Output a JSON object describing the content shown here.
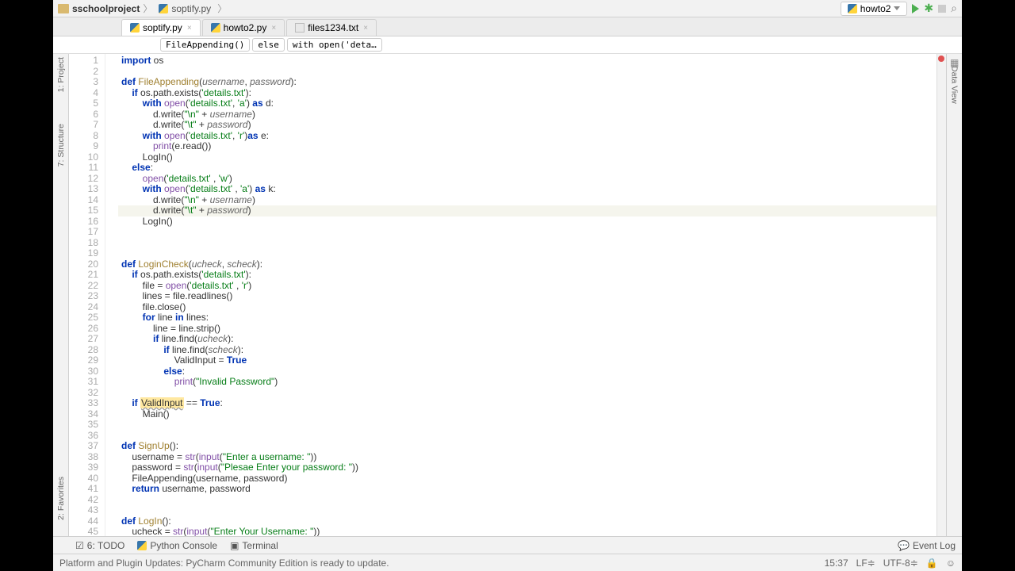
{
  "breadcrumb": {
    "project": "sschoolproject",
    "file": "soptify.py"
  },
  "run_config": "howto2",
  "tabs": [
    {
      "name": "soptify.py",
      "type": "py",
      "active": true
    },
    {
      "name": "howto2.py",
      "type": "py",
      "active": false
    },
    {
      "name": "files1234.txt",
      "type": "txt",
      "active": false
    }
  ],
  "context": [
    "FileAppending()",
    "else",
    "with open('deta…"
  ],
  "left_tools": [
    "1: Project",
    "7: Structure"
  ],
  "bottom_left_tool": "2: Favorites",
  "right_tool": "Data View",
  "bottom_tools": {
    "todo": "6: TODO",
    "console": "Python Console",
    "terminal": "Terminal",
    "event_log": "Event Log"
  },
  "status": {
    "msg": "Platform and Plugin Updates: PyCharm Community Edition is ready to update.",
    "time": "15:37",
    "sep": "LF≑",
    "enc": "UTF-8≑"
  },
  "code": [
    {
      "n": 1,
      "t": "<span class='kw'>import</span> os"
    },
    {
      "n": 2,
      "t": ""
    },
    {
      "n": 3,
      "t": "<span class='kw'>def</span> <span class='fn'>FileAppending</span>(<span class='param'>username</span>, <span class='param'>password</span>):"
    },
    {
      "n": 4,
      "t": "    <span class='kw'>if</span> os.path.exists(<span class='str'>'details.txt'</span>):"
    },
    {
      "n": 5,
      "t": "        <span class='kw'>with</span> <span class='bi'>open</span>(<span class='str'>'details.txt'</span>, <span class='str'>'a'</span>) <span class='kw'>as</span> d:"
    },
    {
      "n": 6,
      "t": "            d.write(<span class='str'>\"\\n\"</span> + <span class='param'>username</span>)"
    },
    {
      "n": 7,
      "t": "            d.write(<span class='str'>\"\\t\"</span> + <span class='param'>password</span>)"
    },
    {
      "n": 8,
      "t": "        <span class='kw'>with</span> <span class='bi'>open</span>(<span class='str'>'details.txt'</span>, <span class='str'>'r'</span>)<span class='kw'>as</span> e:"
    },
    {
      "n": 9,
      "t": "            <span class='bi'>print</span>(e.read())"
    },
    {
      "n": 10,
      "t": "        LogIn()"
    },
    {
      "n": 11,
      "t": "    <span class='kw'>else</span>:"
    },
    {
      "n": 12,
      "t": "        <span class='bi'>open</span>(<span class='str'>'details.txt'</span> , <span class='str'>'w'</span>)"
    },
    {
      "n": 13,
      "t": "        <span class='kw'>with</span> <span class='bi'>open</span>(<span class='str'>'details.txt'</span> , <span class='str'>'a'</span>) <span class='kw'>as</span> k:"
    },
    {
      "n": 14,
      "t": "            d.write(<span class='str'>\"\\n\"</span> + <span class='param'>username</span>)"
    },
    {
      "n": 15,
      "t": "            d.write(<span class='str'>\"\\t\"</span> + <span class='param'>password</span>)",
      "hl": true
    },
    {
      "n": 16,
      "t": "        LogIn()"
    },
    {
      "n": 17,
      "t": ""
    },
    {
      "n": 18,
      "t": ""
    },
    {
      "n": 19,
      "t": ""
    },
    {
      "n": 20,
      "t": "<span class='kw'>def</span> <span class='fn'>LoginCheck</span>(<span class='param'>ucheck</span>, <span class='param'>scheck</span>):"
    },
    {
      "n": 21,
      "t": "    <span class='kw'>if</span> os.path.exists(<span class='str'>'details.txt'</span>):"
    },
    {
      "n": 22,
      "t": "        file = <span class='bi'>open</span>(<span class='str'>'details.txt'</span> , <span class='str'>'r'</span>)"
    },
    {
      "n": 23,
      "t": "        lines = file.readlines()"
    },
    {
      "n": 24,
      "t": "        file.close()"
    },
    {
      "n": 25,
      "t": "        <span class='kw'>for</span> line <span class='kw'>in</span> lines:"
    },
    {
      "n": 26,
      "t": "            line = line.strip()"
    },
    {
      "n": 27,
      "t": "            <span class='kw'>if</span> line.find(<span class='param'>ucheck</span>):"
    },
    {
      "n": 28,
      "t": "                <span class='kw'>if</span> line.find(<span class='param'>scheck</span>):"
    },
    {
      "n": 29,
      "t": "                    ValidInput = <span class='kw'>True</span>"
    },
    {
      "n": 30,
      "t": "                <span class='kw'>else</span>:"
    },
    {
      "n": 31,
      "t": "                    <span class='bi'>print</span>(<span class='str'>\"Invalid Password\"</span>)"
    },
    {
      "n": 32,
      "t": ""
    },
    {
      "n": 33,
      "t": "    <span class='kw'>if</span> <span class='underline'>ValidInput</span> == <span class='kw'>True</span>:"
    },
    {
      "n": 34,
      "t": "        Main()"
    },
    {
      "n": 35,
      "t": ""
    },
    {
      "n": 36,
      "t": ""
    },
    {
      "n": 37,
      "t": "<span class='kw'>def</span> <span class='fn'>SignUp</span>():"
    },
    {
      "n": 38,
      "t": "    username = <span class='bi'>str</span>(<span class='bi'>input</span>(<span class='str'>\"Enter a username: \"</span>))"
    },
    {
      "n": 39,
      "t": "    password = <span class='bi'>str</span>(<span class='bi'>input</span>(<span class='str'>\"Plesae Enter your password: \"</span>))"
    },
    {
      "n": 40,
      "t": "    FileAppending(username, password)"
    },
    {
      "n": 41,
      "t": "    <span class='kw'>return</span> username, password"
    },
    {
      "n": 42,
      "t": ""
    },
    {
      "n": 43,
      "t": ""
    },
    {
      "n": 44,
      "t": "<span class='kw'>def</span> <span class='fn'>LogIn</span>():"
    },
    {
      "n": 45,
      "t": "    ucheck = <span class='bi'>str</span>(<span class='bi'>input</span>(<span class='str'>\"Enter Your Username: \"</span>))"
    }
  ]
}
